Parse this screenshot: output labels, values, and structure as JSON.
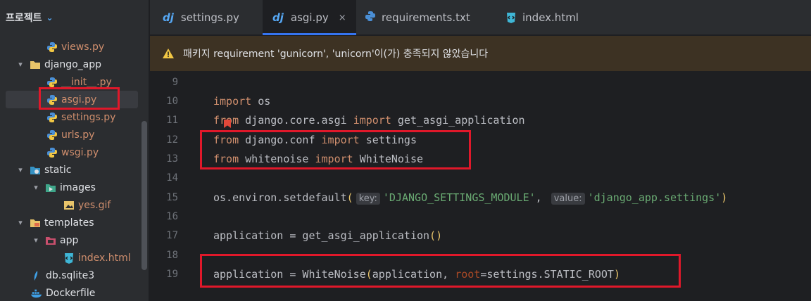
{
  "project": {
    "title": "프로젝트"
  },
  "tree": {
    "views": "views.py",
    "django_app": "django_app",
    "init": "__init__.py",
    "asgi": "asgi.py",
    "settings": "settings.py",
    "urls": "urls.py",
    "wsgi": "wsgi.py",
    "static": "static",
    "images": "images",
    "yes_gif": "yes.gif",
    "templates": "templates",
    "app": "app",
    "index_html": "index.html",
    "db": "db.sqlite3",
    "dockerfile": "Dockerfile"
  },
  "tabs": [
    {
      "label": "settings.py"
    },
    {
      "label": "asgi.py",
      "close": "×"
    },
    {
      "label": "requirements.txt"
    },
    {
      "label": "index.html"
    }
  ],
  "banner": {
    "text": "패키지 requirement 'gunicorn', 'unicorn'이(가) 충족되지 않았습니다"
  },
  "editor": {
    "line_numbers": [
      "9",
      "10",
      "11",
      "12",
      "13",
      "14",
      "15",
      "16",
      "17",
      "18",
      "19"
    ],
    "hint_key": "key:",
    "hint_value": "value:"
  },
  "colors": {
    "accent": "#3574f0",
    "highlight_box": "#e0182a",
    "keyword": "#cf8e6d",
    "string": "#6aab73"
  }
}
